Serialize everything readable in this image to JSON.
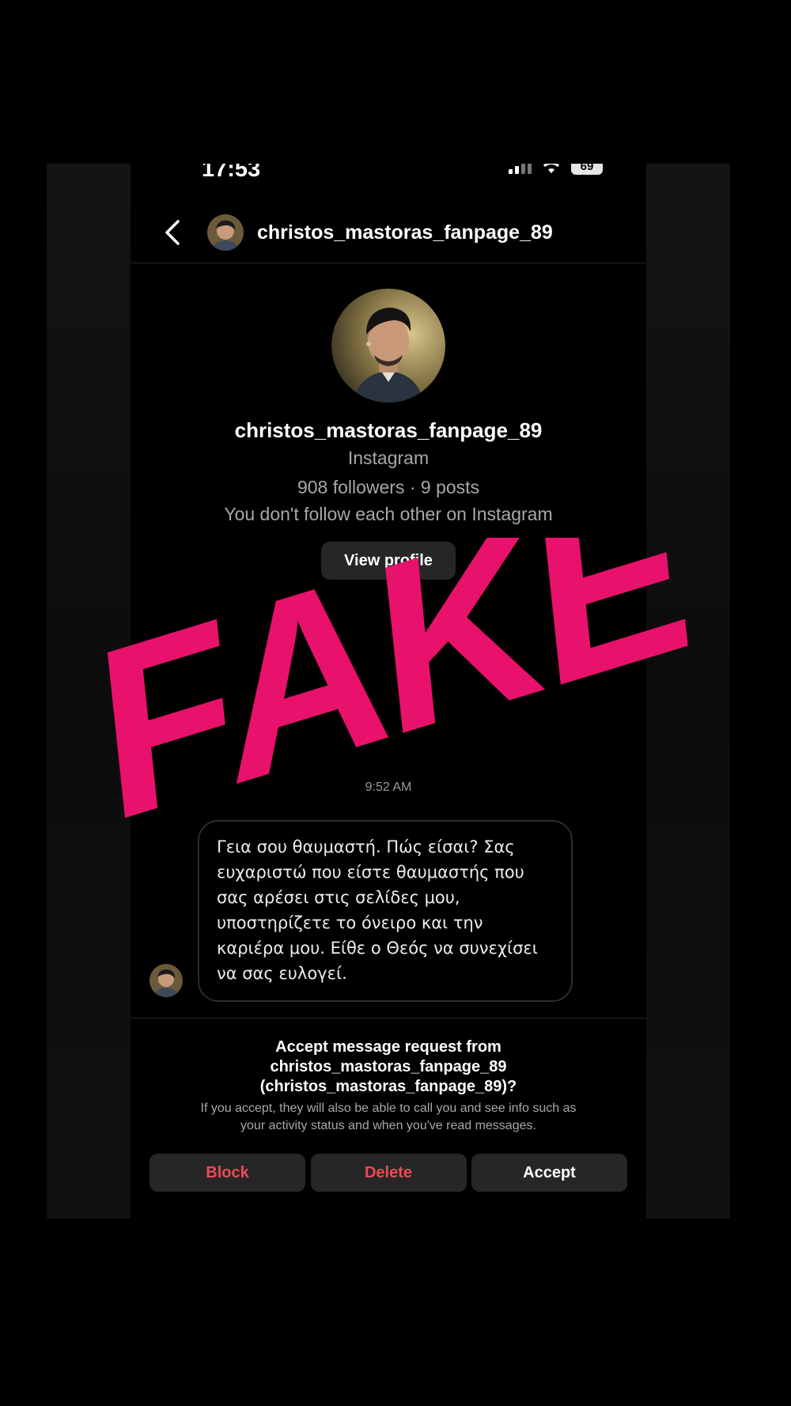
{
  "status_bar": {
    "time": "17:53",
    "battery": "69"
  },
  "header": {
    "back_icon": "chevron-left-icon",
    "username": "christos_mastoras_fanpage_89"
  },
  "profile": {
    "username": "christos_mastoras_fanpage_89",
    "platform": "Instagram",
    "stats": "908 followers · 9 posts",
    "follow_status": "You don't follow each other on Instagram",
    "view_profile_label": "View profile"
  },
  "message": {
    "timestamp": "9:52 AM",
    "lines": [
      "Γεια σου θαυμαστή. Πώς είσαι? Σας",
      "ευχαριστώ που είστε θαυμαστής που",
      "σας αρέσει στις σελίδες μου,",
      "υποστηρίζετε το όνειρο και την",
      "καριέρα μου. Είθε ο Θεός να συνεχίσει",
      "να σας ευλογεί."
    ]
  },
  "request": {
    "title_lines": [
      "Accept message request from",
      "christos_mastoras_fanpage_89",
      "(christos_mastoras_fanpage_89)?"
    ],
    "note_lines": [
      "If you accept, they will also be able to call you and see info such as",
      "your activity status and when you've read messages."
    ],
    "block_label": "Block",
    "delete_label": "Delete",
    "accept_label": "Accept"
  },
  "overlay": {
    "stamp_text": "FAKE",
    "stamp_color": "#e8116b"
  },
  "colors": {
    "background": "#000000",
    "button_bg": "#262626",
    "danger": "#ed4956",
    "secondary_text": "#a8a8a8"
  }
}
